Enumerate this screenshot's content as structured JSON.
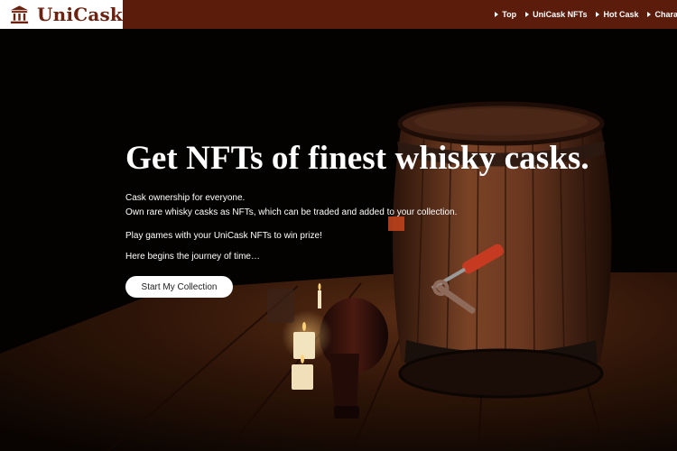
{
  "brand": {
    "name": "UniCask",
    "logo_icon": "building-icon"
  },
  "nav": {
    "items": [
      {
        "label": "Top"
      },
      {
        "label": "UniCask NFTs"
      },
      {
        "label": "Hot Cask"
      },
      {
        "label": "Charac"
      }
    ]
  },
  "hero": {
    "headline": "Get NFTs of finest whisky casks.",
    "lines": [
      "Cask ownership for everyone.",
      "Own rare whisky casks as NFTs, which can be traded and added to your collection.",
      "Play games with your UniCask NFTs to win prize!",
      "Here begins the journey of time…"
    ],
    "cta_label": "Start My Collection"
  },
  "colors": {
    "header_bg": "#5b1c0c",
    "brand_text": "#6b2210",
    "cta_bg": "#ffffff"
  }
}
